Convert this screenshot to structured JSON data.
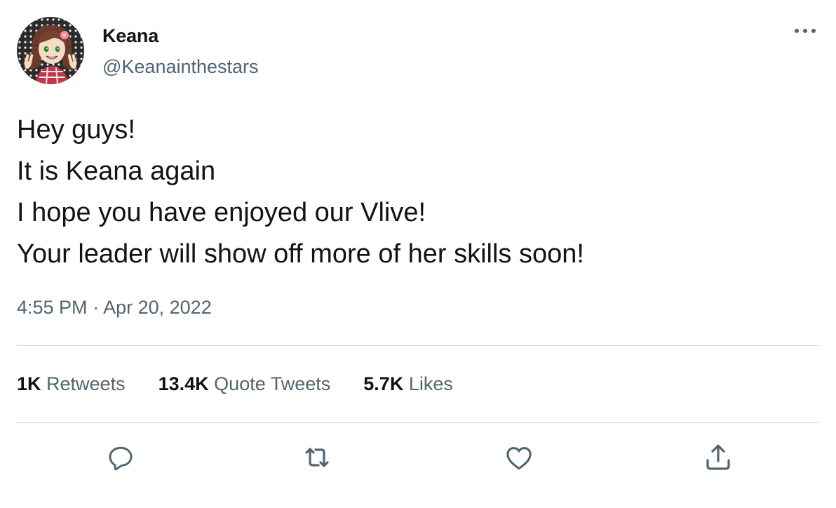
{
  "author": {
    "display_name": "Keana",
    "handle": "@Keanainthestars",
    "avatar_icon": "avatar-illustration"
  },
  "tweet": {
    "lines": [
      "Hey guys!",
      "It is Keana again",
      "I hope you have enjoyed our Vlive!",
      "Your leader will show off more of her skills soon!"
    ],
    "time": "4:55 PM",
    "separator": "·",
    "date": "Apr 20, 2022"
  },
  "stats": {
    "retweets_count": "1K",
    "retweets_label": "Retweets",
    "quotes_count": "13.4K",
    "quotes_label": "Quote Tweets",
    "likes_count": "5.7K",
    "likes_label": "Likes"
  },
  "actions": [
    {
      "icon": "reply-icon"
    },
    {
      "icon": "retweet-icon"
    },
    {
      "icon": "like-icon"
    },
    {
      "icon": "share-icon"
    }
  ],
  "colors": {
    "text": "#0f1419",
    "secondary": "#536471",
    "divider": "#cfd9de"
  }
}
